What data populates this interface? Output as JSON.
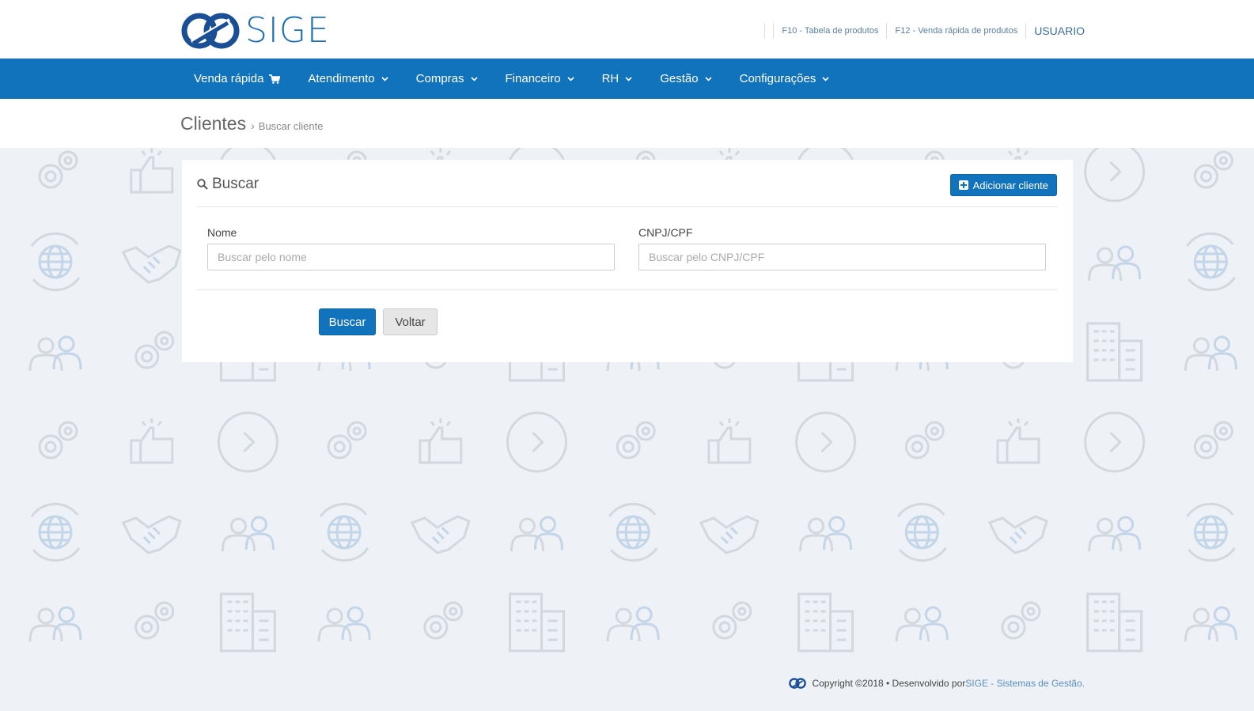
{
  "header": {
    "logo_text": "SIGE",
    "links": [
      {
        "label": "F10 - Tabela de produtos"
      },
      {
        "label": "F12 - Venda rápida de produtos"
      }
    ],
    "user": "USUARIO"
  },
  "nav": {
    "items": [
      {
        "label": "Venda rápida",
        "icon": "cart-icon"
      },
      {
        "label": "Atendimento",
        "icon": "chevron-down-icon"
      },
      {
        "label": "Compras",
        "icon": "chevron-down-icon"
      },
      {
        "label": "Financeiro",
        "icon": "chevron-down-icon"
      },
      {
        "label": "RH",
        "icon": "chevron-down-icon"
      },
      {
        "label": "Gestão",
        "icon": "chevron-down-icon"
      },
      {
        "label": "Configurações",
        "icon": "chevron-down-icon"
      }
    ]
  },
  "breadcrumb": {
    "title": "Clientes",
    "separator": "›",
    "current": "Buscar cliente"
  },
  "search": {
    "title": "Buscar",
    "add_label": "Adicionar cliente",
    "fields": {
      "name": {
        "label": "Nome",
        "value": "",
        "placeholder": "Buscar pelo nome"
      },
      "doc": {
        "label": "CNPJ/CPF",
        "value": "",
        "placeholder": "Buscar pelo CNPJ/CPF"
      }
    },
    "submit_label": "Buscar",
    "back_label": "Voltar"
  },
  "footer": {
    "text": "Copyright ©2018 • Desenvolvido por ",
    "link": "SIGE - Sistemas de Gestão."
  },
  "colors": {
    "primary": "#1273bd",
    "background": "#eef1f5"
  }
}
